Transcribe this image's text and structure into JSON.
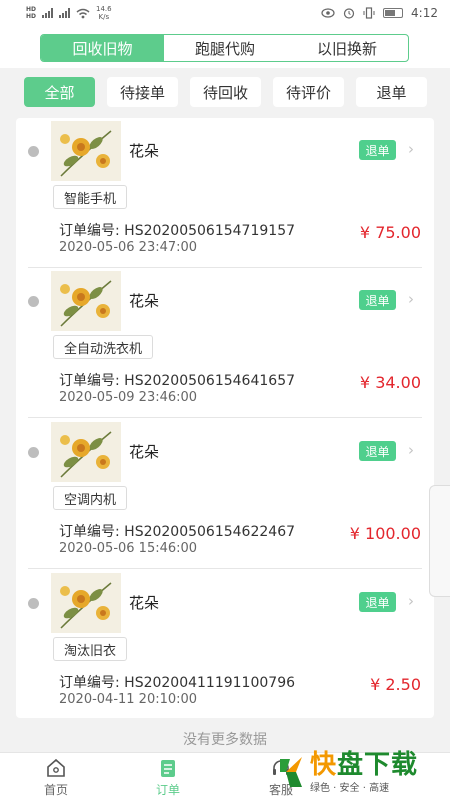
{
  "status_bar": {
    "speed": "14.6",
    "speed_unit": "K/s",
    "time": "4:12"
  },
  "header": {
    "tabs": [
      "回收旧物",
      "跑腿代购",
      "以旧换新"
    ],
    "active_tab": 0
  },
  "filters": {
    "items": [
      "全部",
      "待接单",
      "待回收",
      "待评价",
      "退单"
    ],
    "active": 0
  },
  "orders": [
    {
      "product": "花朵",
      "badge": "退单",
      "category": "智能手机",
      "order_no": "订单编号: HS20200506154719157",
      "time": "2020-05-06 23:47:00",
      "price": "¥ 75.00"
    },
    {
      "product": "花朵",
      "badge": "退单",
      "category": "全自动洗衣机",
      "order_no": "订单编号: HS20200506154641657",
      "time": "2020-05-09 23:46:00",
      "price": "¥ 34.00"
    },
    {
      "product": "花朵",
      "badge": "退单",
      "category": "空调内机",
      "order_no": "订单编号: HS20200506154622467",
      "time": "2020-05-06 15:46:00",
      "price": "¥ 100.00"
    },
    {
      "product": "花朵",
      "badge": "退单",
      "category": "淘汰旧衣",
      "order_no": "订单编号: HS20200411191100796",
      "time": "2020-04-11 20:10:00",
      "price": "¥ 2.50"
    }
  ],
  "no_more": "没有更多数据",
  "tabbar": {
    "items": [
      {
        "label": "首页",
        "icon": "home-icon"
      },
      {
        "label": "订单",
        "icon": "order-icon"
      },
      {
        "label": "客服",
        "icon": "headset-icon"
      }
    ],
    "active": 1
  },
  "watermark": {
    "main_a": "快",
    "main_b": "盘下载",
    "sub": "绿色 · 安全 · 高速"
  },
  "colors": {
    "accent": "#5dcc8c",
    "price": "#e3262d"
  }
}
